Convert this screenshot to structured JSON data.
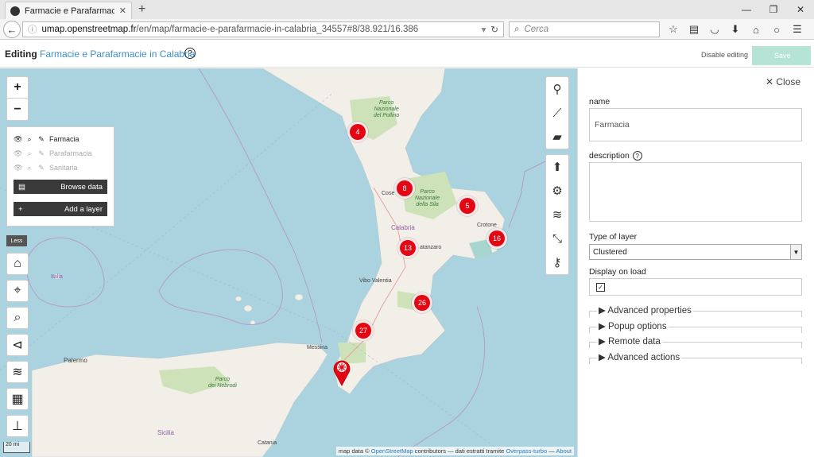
{
  "browser": {
    "tab_title": "Farmacie e Parafarmacie i...",
    "url_host": "umap.openstreetmap.fr",
    "url_path": "/en/map/farmacie-e-parafarmacie-in-calabria_34557#8/38.921/16.386",
    "search_placeholder": "Cerca"
  },
  "header": {
    "editing_label": "Editing",
    "map_name": "Farmacie e Parafarmacie in Calabria",
    "help": "?",
    "disable_editing": "Disable editing",
    "save": "Save"
  },
  "layers_panel": {
    "layers": [
      {
        "name": "Farmacia",
        "visible": true
      },
      {
        "name": "Parafarmacia",
        "visible": false
      },
      {
        "name": "Sanitaria",
        "visible": false
      }
    ],
    "browse_data": "Browse data",
    "add_layer": "Add a layer",
    "less": "Less"
  },
  "zoom": {
    "in": "+",
    "out": "−"
  },
  "clusters": [
    "4",
    "8",
    "5",
    "16",
    "13",
    "26",
    "27"
  ],
  "map_labels": {
    "parco_pollino": "Parco\nNazionale\ndel Pollino",
    "parco_sila": "Parco\nNazionale\ndella Sila",
    "parco_nebrodi": "Parco\ndei Nebrodi",
    "cosenza": "Cose",
    "calabria": "Calabria",
    "catanzaro": "atanzaro",
    "crotone": "Crotone",
    "vibo": "Vibo Valentia",
    "italia": "Italia",
    "palermo": "Palermo",
    "messina": "Messina",
    "sicilia": "Sicilia",
    "catania": "Catania"
  },
  "scale": "20 mi",
  "attribution": {
    "prefix": "map data ©",
    "osm": "OpenStreetMap",
    "middle": "contributors — dati estratti tramite",
    "overpass": "Overpass-turbo",
    "sep": "—",
    "about": "About"
  },
  "side_panel": {
    "close": "Close",
    "name_label": "name",
    "name_value": "Farmacia",
    "description_label": "description",
    "type_label": "Type of layer",
    "type_value": "Clustered",
    "display_on_load_label": "Display on load",
    "sections": [
      "Advanced properties",
      "Popup options",
      "Remote data",
      "Advanced actions"
    ]
  },
  "colors": {
    "sea": "#aad3df",
    "land": "#f2efe9",
    "cluster": "#e30613",
    "link": "#3e8fc4",
    "save": "#b5e3d6"
  }
}
